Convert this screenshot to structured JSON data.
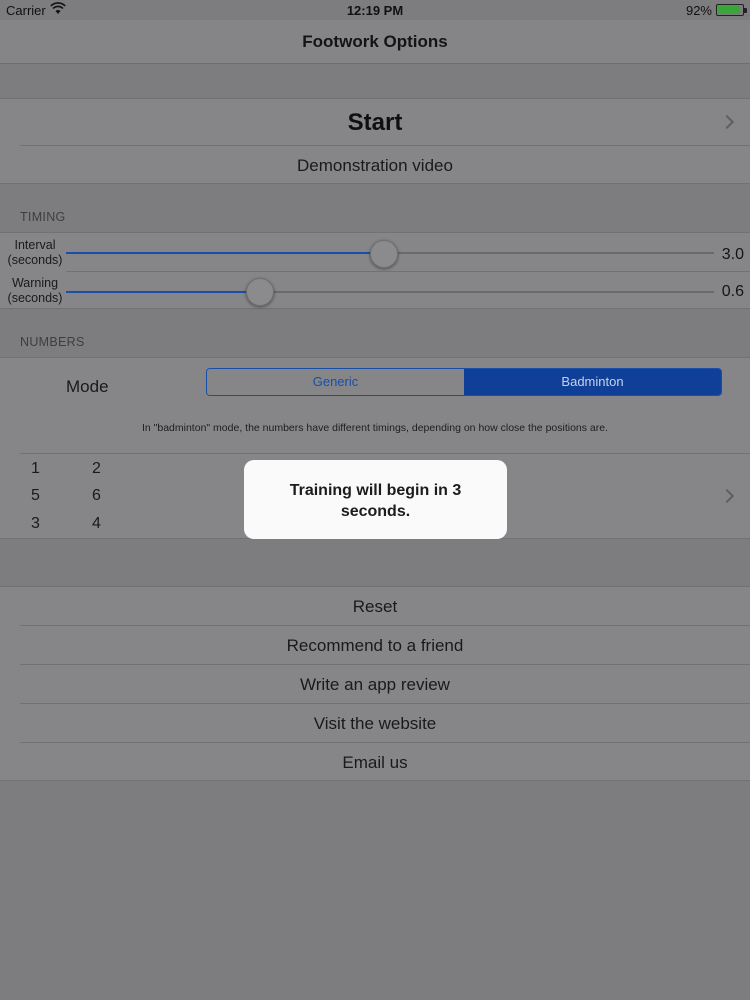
{
  "status_bar": {
    "carrier": "Carrier",
    "time": "12:19 PM",
    "battery": "92%",
    "battery_level": 0.92
  },
  "navbar": {
    "title": "Footwork Options"
  },
  "top_group": {
    "start_label": "Start",
    "demo_label": "Demonstration video"
  },
  "timing": {
    "header": "TIMING",
    "interval": {
      "label_line1": "Interval",
      "label_line2": "(seconds)",
      "value": "3.0",
      "fraction": 0.49
    },
    "warning": {
      "label_line1": "Warning",
      "label_line2": "(seconds)",
      "value": "0.6",
      "fraction": 0.3
    }
  },
  "numbers": {
    "header": "NUMBERS",
    "mode_label": "Mode",
    "mode_options": [
      "Generic",
      "Badminton"
    ],
    "selected_mode": "Badminton",
    "note": "In \"badminton\" mode, the numbers have different timings, depending on how close the positions are.",
    "grid": [
      [
        "1",
        "2"
      ],
      [
        "5",
        "6"
      ],
      [
        "3",
        "4"
      ]
    ]
  },
  "toast": {
    "line1": "Training will begin in 3",
    "line2": "seconds."
  },
  "bottom_group": {
    "items": [
      "Reset",
      "Recommend to a friend",
      "Write an app review",
      "Visit the website",
      "Email us"
    ]
  },
  "colors": {
    "accent": "#184ea6",
    "overlay_gray": "#7d7d80",
    "toast_bg": "#fafafa"
  }
}
